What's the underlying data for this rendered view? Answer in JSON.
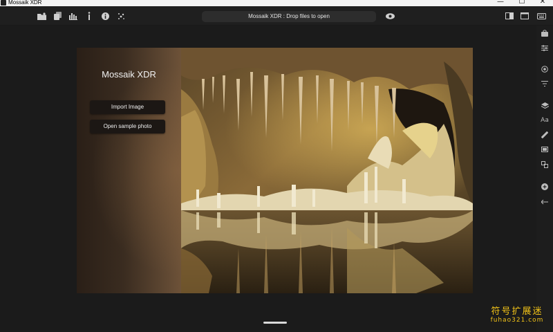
{
  "window": {
    "title": "Mossaik XDR",
    "controls": {
      "minimize": "—",
      "maximize": "☐",
      "close": "✕"
    }
  },
  "toolbar": {
    "left_icons": [
      "open-folder-icon",
      "copy-icon",
      "histogram-icon",
      "info-text-icon",
      "info-icon",
      "sparkle-icon"
    ],
    "drop_label": "Mossaik XDR : Drop files to open",
    "right_icons": [
      "eye-icon",
      "sidebar-icon",
      "window-icon",
      "keyboard-icon"
    ]
  },
  "panel": {
    "app_name": "Mossaik XDR",
    "import_label": "Import Image",
    "sample_label": "Open sample photo"
  },
  "right_rail": {
    "text_icon_label": "Aa"
  },
  "watermark": {
    "cn": "符号扩展迷",
    "en": "fuhao321.com"
  },
  "colors": {
    "background": "#1b1b1b",
    "toolbar": "#1f1f1f",
    "accent_watermark": "#f2c318"
  }
}
